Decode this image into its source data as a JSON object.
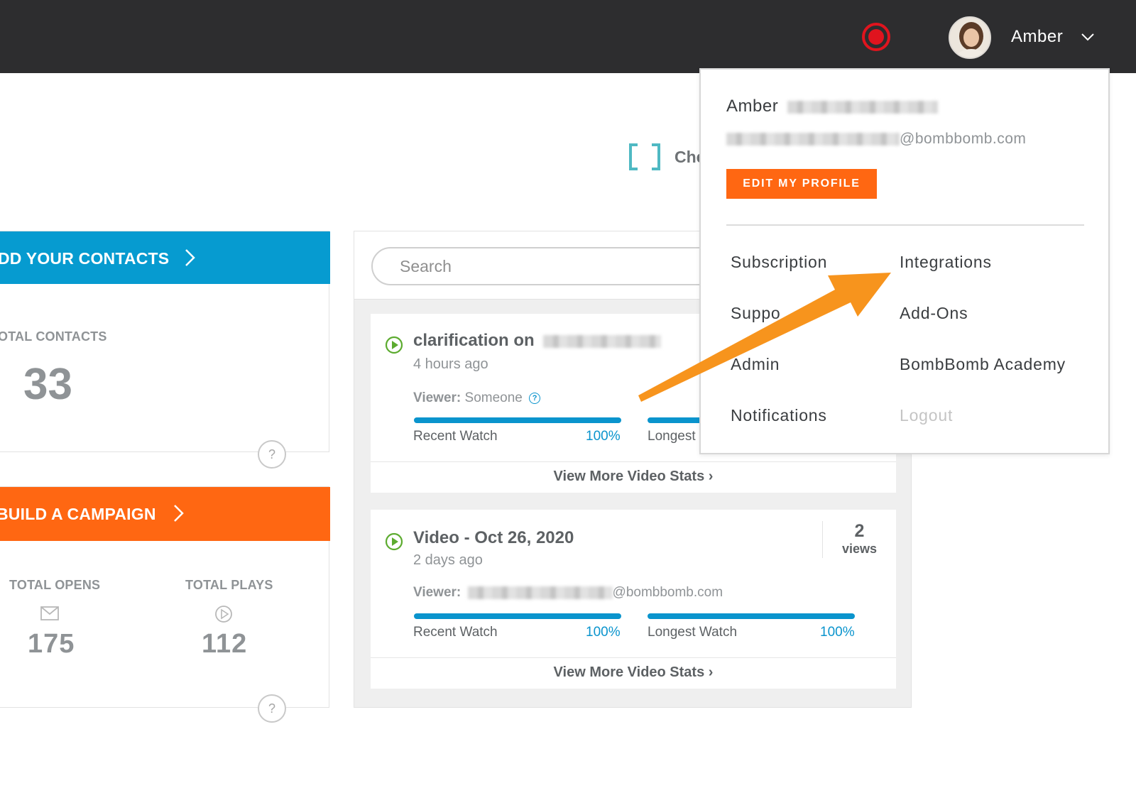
{
  "topbar": {
    "user_name": "Amber"
  },
  "contacts_card": {
    "banner_label": "DD YOUR CONTACTS",
    "stat_label": "OTAL CONTACTS",
    "stat_value": "33",
    "help": "?"
  },
  "campaign_card": {
    "banner_label": "BUILD A CAMPAIGN",
    "opens_label": "TOTAL OPENS",
    "opens_value": "175",
    "plays_label": "TOTAL PLAYS",
    "plays_value": "112",
    "help": "?"
  },
  "check_link": {
    "text": "Che"
  },
  "search": {
    "placeholder": "Search"
  },
  "videos": [
    {
      "title": "clarification on",
      "time": "4 hours ago",
      "viewer_label": "Viewer:",
      "viewer_value": "Someone",
      "help_glyph": "?",
      "recent_label": "Recent Watch",
      "recent_pct": "100%",
      "recent_progress": 1.0,
      "longest_label": "Longest",
      "more": "View More Video Stats ›"
    },
    {
      "title": "Video - Oct 26, 2020",
      "time": "2 days ago",
      "views_count": "2",
      "views_label": "views",
      "viewer_label": "Viewer:",
      "viewer_value": "@bombbomb.com",
      "recent_label": "Recent Watch",
      "recent_pct": "100%",
      "recent_progress": 1.0,
      "longest_label": "Longest Watch",
      "longest_pct": "100%",
      "longest_progress": 1.0,
      "more": "View More Video Stats ›"
    }
  ],
  "dropdown": {
    "name": "Amber",
    "email_suffix": "@bombbomb.com",
    "edit_profile": "EDIT MY PROFILE",
    "items_left": [
      "Subscription",
      "Suppo",
      "Admin",
      "Notifications"
    ],
    "items_right": [
      "Integrations",
      "Add-Ons",
      "BombBomb Academy",
      "Logout"
    ]
  },
  "colors": {
    "topbar": "#2d2d2f",
    "blue_banner": "#069bd0",
    "orange_banner": "#ff6712",
    "record_red": "#e0141e",
    "progress_blue": "#0a94cd",
    "annotation_arrow": "#f7941d",
    "check_icon": "#4fb9c3",
    "play_icon": "#5cab2f"
  },
  "icons": {
    "record": "record-icon",
    "chevron_down": "chevron-down-icon",
    "chevron_right": "chevron-right-icon",
    "mail": "mail-icon",
    "play": "play-circle-icon",
    "help": "help-icon",
    "check_bracket": "bracket-icon"
  }
}
